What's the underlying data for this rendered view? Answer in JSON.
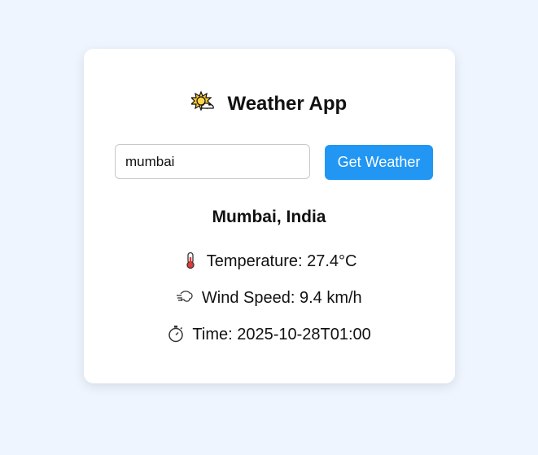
{
  "app": {
    "title": "Weather App",
    "title_icon": "sun-behind-cloud-icon"
  },
  "search": {
    "value": "mumbai",
    "button_label": "Get Weather"
  },
  "result": {
    "location": "Mumbai, India",
    "temperature": "Temperature: 27.4°C",
    "temperature_icon": "thermometer-icon",
    "wind_speed": "Wind Speed: 9.4 km/h",
    "wind_icon": "wind-icon",
    "time": "Time: 2025-10-28T01:00",
    "time_icon": "stopwatch-icon"
  },
  "colors": {
    "background": "#eef5ff",
    "card": "#ffffff",
    "accent": "#2196f3"
  }
}
